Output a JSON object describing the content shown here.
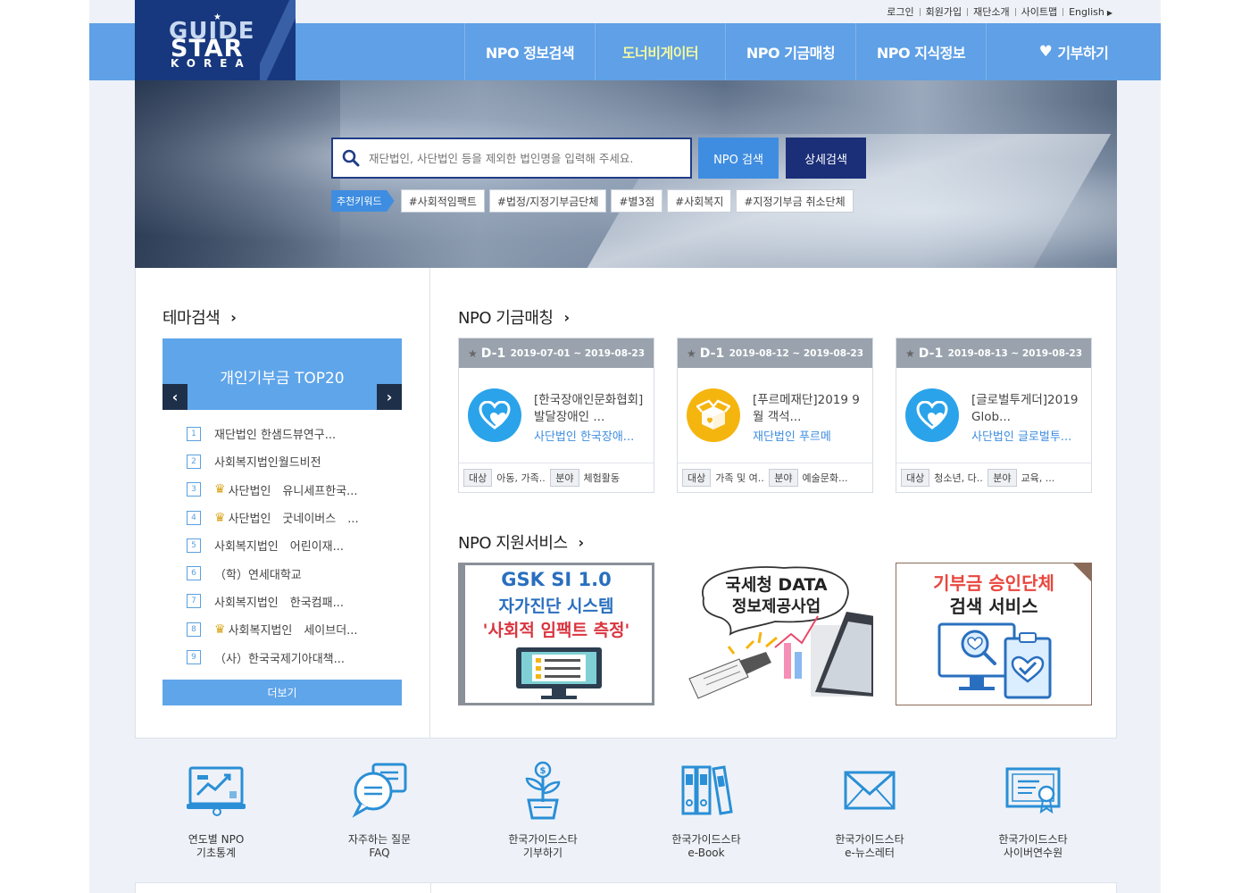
{
  "util_links": [
    "로그인",
    "회원가입",
    "재단소개",
    "사이트맵",
    "English"
  ],
  "logo": {
    "line1": "GUIDE",
    "line2": "STAR",
    "line3": "KOREA"
  },
  "nav": [
    {
      "label": "NPO 정보검색",
      "active": false
    },
    {
      "label": "도너비게이터",
      "active": true
    },
    {
      "label": "NPO 기금매칭",
      "active": false
    },
    {
      "label": "NPO 지식정보",
      "active": false
    },
    {
      "label": "기부하기",
      "active": false,
      "icon": "heart-icon"
    }
  ],
  "search": {
    "placeholder": "재단법인, 사단법인 등을 제외한 법인명을 입력해 주세요.",
    "btn_npo": "NPO 검색",
    "btn_detail": "상세검색",
    "keyword_label": "추천키워드",
    "keywords": [
      "#사회적임팩트",
      "#법정/지정기부금단체",
      "#별3점",
      "#사회복지",
      "#지정기부금 취소단체"
    ]
  },
  "theme": {
    "title": "테마검색",
    "banner": "개인기부금 TOP20",
    "ranking": [
      {
        "num": "1",
        "name": "재단법인 한샘드뷰연구...",
        "crown": false
      },
      {
        "num": "2",
        "name": "사회복지법인월드비전",
        "crown": false
      },
      {
        "num": "3",
        "name": "사단법인　유니세프한국...",
        "crown": true
      },
      {
        "num": "4",
        "name": "사단법인　굿네이버스　...",
        "crown": true
      },
      {
        "num": "5",
        "name": "사회복지법인　어린이재...",
        "crown": false
      },
      {
        "num": "6",
        "name": "（학）연세대학교",
        "crown": false
      },
      {
        "num": "7",
        "name": "사회복지법인　한국컴패...",
        "crown": false
      },
      {
        "num": "8",
        "name": "사회복지법인　세이브더...",
        "crown": true
      },
      {
        "num": "9",
        "name": "（사）한국국제기아대책...",
        "crown": false
      }
    ],
    "more": "더보기"
  },
  "matching": {
    "title": "NPO 기금매칭",
    "cards": [
      {
        "dday": "D-1",
        "period": "2019-07-01 ~ 2019-08-23",
        "title": "[한국장애인문화협회]발달장애인 ...",
        "org": "사단법인 한국장애...",
        "target_label": "대상",
        "target": "아동, 가족...",
        "field_label": "분야",
        "field": "체험활동",
        "icon": "heart-icon",
        "color": "#2aa3ea"
      },
      {
        "dday": "D-1",
        "period": "2019-08-12 ~ 2019-08-23",
        "title": "[푸르메재단]2019 9월 객석...",
        "org": "재단법인 푸르메",
        "target_label": "대상",
        "target": "가족 및 여...",
        "field_label": "분야",
        "field": "예술문화...",
        "icon": "gift-box-icon",
        "color": "#f5b50f"
      },
      {
        "dday": "D-1",
        "period": "2019-08-13 ~ 2019-08-23",
        "title": "[글로벌투게더]2019 Glob...",
        "org": "사단법인 글로벌투...",
        "target_label": "대상",
        "target": "청소년, 다...",
        "field_label": "분야",
        "field": "교육, ...",
        "icon": "heart-icon",
        "color": "#2aa3ea"
      }
    ]
  },
  "support": {
    "title": "NPO 지원서비스",
    "banners": [
      {
        "line1": "GSK SI 1.0",
        "line2": "자가진단 시스템",
        "line3": "'사회적 임팩트 측정'"
      },
      {
        "line1": "국세청 DATA",
        "line2": "정보제공사업"
      },
      {
        "line1": "기부금 승인단체",
        "line2": "검색 서비스"
      }
    ]
  },
  "quick_links": [
    {
      "line1": "연도별 NPO",
      "line2": "기초통계",
      "icon": "statistics-monitor-icon"
    },
    {
      "line1": "자주하는 질문",
      "line2": "FAQ",
      "icon": "speech-bubbles-icon"
    },
    {
      "line1": "한국가이드스타",
      "line2": "기부하기",
      "icon": "money-plant-icon"
    },
    {
      "line1": "한국가이드스타",
      "line2": "e-Book",
      "icon": "binders-icon"
    },
    {
      "line1": "한국가이드스타",
      "line2": "e-뉴스레터",
      "icon": "envelope-icon"
    },
    {
      "line1": "한국가이드스타",
      "line2": "사이버연수원",
      "icon": "certificate-icon"
    }
  ]
}
